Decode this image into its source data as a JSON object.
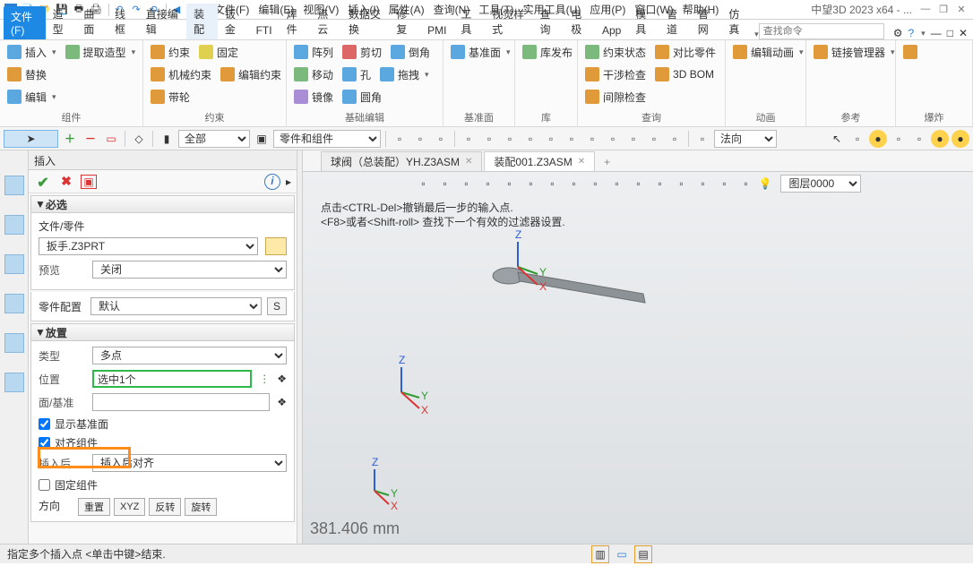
{
  "app": {
    "title": "中望3D 2023 x64 - ..."
  },
  "menubar": [
    "文件(F)",
    "编辑(E)",
    "视图(V)",
    "插入(I)",
    "属性(A)",
    "查询(N)",
    "工具(T)",
    "实用工具(U)",
    "应用(P)",
    "窗口(W)",
    "帮助(H)"
  ],
  "search_placeholder": "查找命令",
  "ribbon_tabs": {
    "file": "文件(F)",
    "items": [
      "造型",
      "曲面",
      "线框",
      "直接编辑",
      "装配",
      "钣金",
      "FTI",
      "焊件",
      "点云",
      "数据交换",
      "修复",
      "PMI",
      "工具",
      "视觉样式",
      "查询",
      "电极",
      "App",
      "模具",
      "管道",
      "管网",
      "仿真"
    ],
    "active_index": 4
  },
  "ribbon": {
    "组件": {
      "rows": [
        [
          "插入",
          "提取造型"
        ],
        [
          "替换"
        ],
        [
          "编辑"
        ]
      ]
    },
    "约束": {
      "rows": [
        [
          "约束",
          "固定"
        ],
        [
          "机械约束",
          "编辑约束"
        ],
        [
          "带轮"
        ]
      ]
    },
    "基础编辑": {
      "rows": [
        [
          "阵列",
          "剪切",
          "倒角"
        ],
        [
          "移动",
          "孔",
          "拖拽"
        ],
        [
          "镜像",
          "圆角"
        ]
      ]
    },
    "基准面": {
      "rows": [
        [
          "基准面"
        ]
      ]
    },
    "库": {
      "rows": [
        [
          "库发布"
        ]
      ]
    },
    "查询": {
      "rows": [
        [
          "约束状态",
          "对比零件"
        ],
        [
          "干涉检查",
          "3D BOM"
        ],
        [
          "间隙检查"
        ]
      ]
    },
    "动画": {
      "rows": [
        [
          "编辑动画"
        ]
      ]
    },
    "参考": {
      "rows": [
        [
          "链接管理器"
        ]
      ]
    },
    "last": {
      "label": "爆炸"
    }
  },
  "quickbar": {
    "filter_all": "全部",
    "filter_hint": "零件和组件",
    "orient": "法向"
  },
  "panel": {
    "title": "插入",
    "sections": {
      "must": {
        "header": "必选",
        "file_label": "文件/零件",
        "file_value": "扳手.Z3PRT",
        "preview_label": "预览",
        "preview_value": "关闭"
      },
      "config": {
        "label": "零件配置",
        "value": "默认",
        "s_btn": "S"
      },
      "place": {
        "header": "放置",
        "type_label": "类型",
        "type_value": "多点",
        "pos_label": "位置",
        "pos_value": "选中1个",
        "face_label": "面/基准",
        "cb_showdatum": "显示基准面",
        "cb_align": "对齐组件",
        "after_label": "插入后",
        "after_value": "插入后对齐",
        "cb_fix": "固定组件",
        "btns": [
          "重置",
          "XYZ",
          "反转",
          "旋转"
        ],
        "orient_label": "方向"
      }
    }
  },
  "tabs": [
    {
      "label": "球阀（总装配）YH.Z3ASM",
      "active": false
    },
    {
      "label": "装配001.Z3ASM",
      "active": true
    }
  ],
  "layer": "图层0000",
  "hints": [
    "点击<CTRL-Del>撤销最后一步的输入点.",
    "<F8>或者<Shift-roll> 查找下一个有效的过滤器设置."
  ],
  "measurement": "381.406 mm",
  "status_text": "指定多个插入点 <单击中键>结束."
}
